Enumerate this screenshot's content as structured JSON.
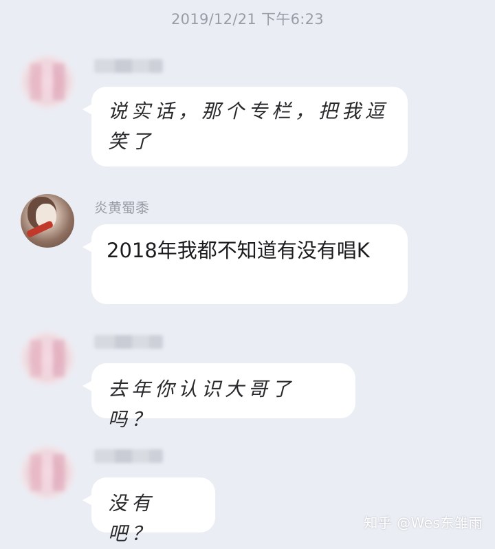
{
  "chat": {
    "timestamp": "2019/12/21 下午6:23",
    "messages": [
      {
        "sender": "",
        "text": "说实话，那个专栏，把我逗笑了"
      },
      {
        "sender": "炎黄蜀黍",
        "text": "2018年我都不知道有没有唱K"
      },
      {
        "sender": "",
        "text": "去年你认识大哥了吗？"
      },
      {
        "sender": "",
        "text": "没有吧？"
      }
    ]
  },
  "watermark": {
    "text": "知乎 @Wes东雏雨"
  }
}
